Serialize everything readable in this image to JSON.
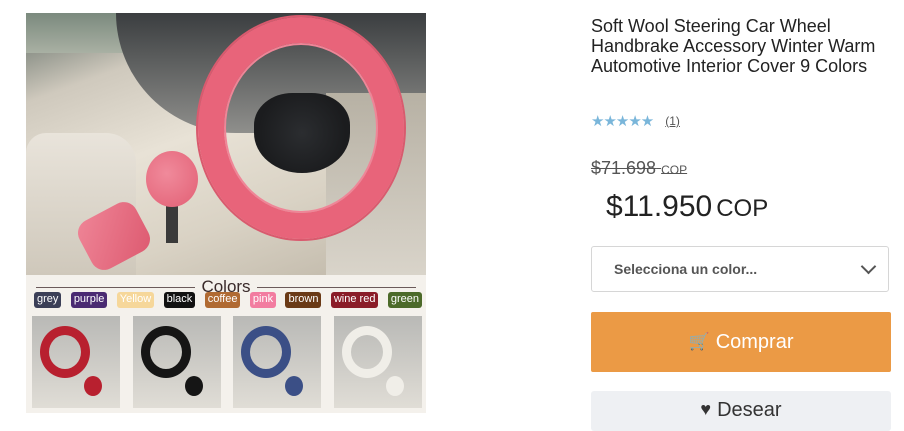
{
  "product": {
    "title": "Soft Wool Steering Car Wheel Handbrake Accessory Winter Warm Automotive Interior Cover 9 Colors",
    "rating_stars": "★★★★★",
    "rating_value": 5,
    "reviews_count": "(1)",
    "old_price": "$71.698",
    "old_price_currency": "COP",
    "price": "$11.950",
    "price_currency": "COP"
  },
  "image": {
    "colors_heading": "Colors",
    "swatches": [
      {
        "label": "grey",
        "color": "#3b3f57"
      },
      {
        "label": "purple",
        "color": "#4a2a72"
      },
      {
        "label": "Yellow",
        "color": "#f6d79a"
      },
      {
        "label": "black",
        "color": "#111111"
      },
      {
        "label": "coffee",
        "color": "#b06a32"
      },
      {
        "label": "pink",
        "color": "#f27ca0"
      },
      {
        "label": "brown",
        "color": "#6a3a16"
      },
      {
        "label": "wine red",
        "color": "#8a1c28"
      },
      {
        "label": "green",
        "color": "#4c6a2a"
      }
    ],
    "thumbnails": [
      {
        "color": "#b8202f"
      },
      {
        "color": "#151515"
      },
      {
        "color": "#3b4f86"
      },
      {
        "color": "#f0eee8"
      }
    ]
  },
  "selector": {
    "placeholder": "Selecciona un color..."
  },
  "actions": {
    "buy_label": "Comprar",
    "wish_label": "Desear"
  },
  "colors": {
    "accent": "#eb9a45",
    "stars": "#7ab6da"
  }
}
